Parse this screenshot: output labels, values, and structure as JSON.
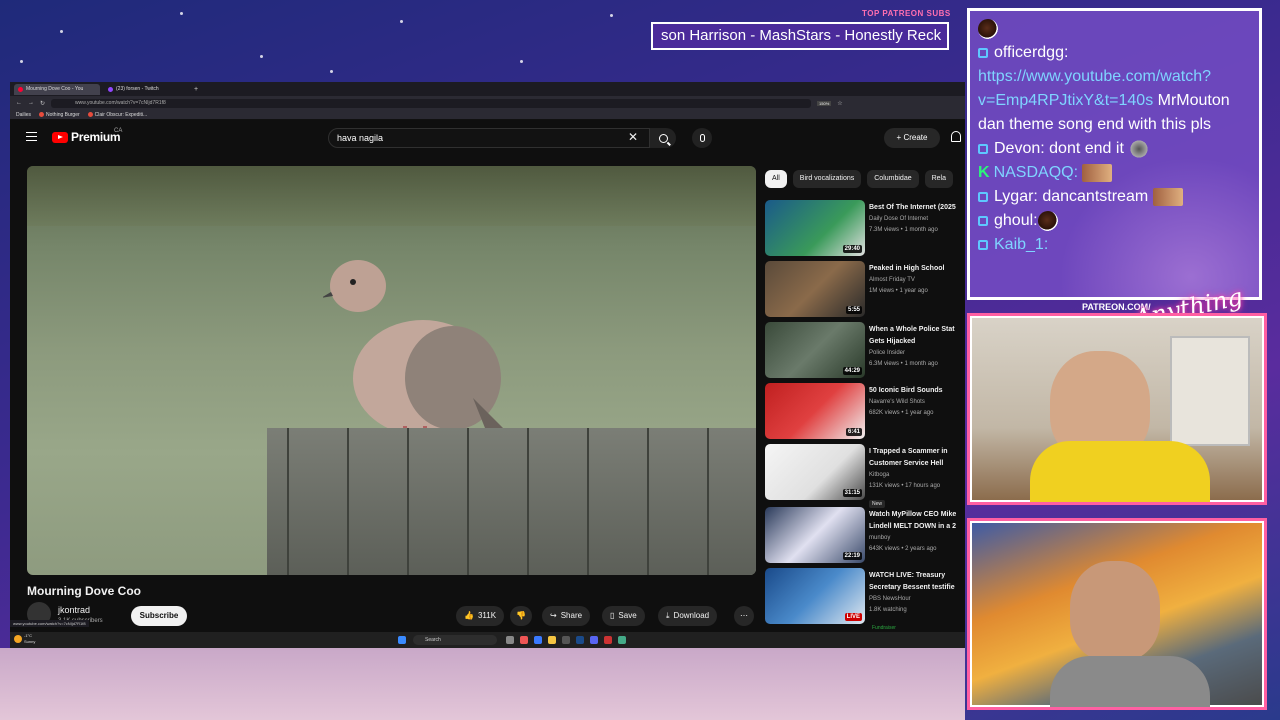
{
  "overlay": {
    "patreon_tag": "TOP PATREON SUBS",
    "ticker": "son Harrison - MashStars - Honestly Reck",
    "patreon_link": "PATREON.COM/",
    "brand_script": "Anything Else?"
  },
  "browser": {
    "tabs": [
      {
        "label": "Mourning Dove Coo - You"
      },
      {
        "label": "(23) forsen - Twitch"
      }
    ],
    "new_tab": "+",
    "url": "www.youtube.com/watch?v=7cNIjd7R1f8",
    "zoom": "150%",
    "bookmarks": [
      "Dailies",
      "Nothing Burger",
      "Clair Obscur: Expediti..."
    ],
    "status_url": "www.youtube.com/watch?v=7cNIjd7R1f8"
  },
  "youtube": {
    "logo_text": "Premium",
    "region": "CA",
    "search_value": "hava nagila",
    "create_label": "Create",
    "video_title": "Mourning Dove Coo",
    "channel_name": "jkontrad",
    "subscribers": "3.1K subscribers",
    "subscribe_label": "Subscribe",
    "like_count": "311K",
    "share_label": "Share",
    "save_label": "Save",
    "download_label": "Download",
    "chips": [
      "All",
      "Bird vocalizations",
      "Columbidae",
      "Rela"
    ],
    "recommendations": [
      {
        "title": "Best Of The Internet (2025",
        "channel": "Daily Dose Of Internet",
        "info": "7.3M views • 1 month ago",
        "duration": "29:40"
      },
      {
        "title": "Peaked in High School",
        "channel": "Almost Friday TV",
        "info": "1M views • 1 year ago",
        "duration": "5:55"
      },
      {
        "title": "When a Whole Police Stat",
        "title2": "Gets Hijacked",
        "channel": "Police Insider",
        "info": "6.3M views • 1 month ago",
        "duration": "44:29"
      },
      {
        "title": "50 Iconic Bird Sounds",
        "channel": "Navarre's Wild Shots",
        "info": "682K views • 1 year ago",
        "duration": "6:41"
      },
      {
        "title": "I Trapped a Scammer in",
        "title2": "Customer Service Hell",
        "channel": "Kitboga",
        "info": "131K views • 17 hours ago",
        "duration": "31:15",
        "badge": "New"
      },
      {
        "title": "Watch MyPillow CEO Mike",
        "title2": "Lindell MELT DOWN in a 2",
        "channel": "munboy",
        "info": "643K views • 2 years ago",
        "duration": "22:19"
      },
      {
        "title": "WATCH LIVE: Treasury",
        "title2": "Secretary Bessent testifie",
        "channel": "PBS NewsHour",
        "info": "1.8K watching",
        "duration": "LIVE",
        "badge": "Fundraiser"
      }
    ]
  },
  "taskbar": {
    "weather_temp": "-1°C",
    "weather_desc": "Sunny",
    "search_placeholder": "Search"
  },
  "chat": {
    "messages": [
      {
        "user": "",
        "text": ""
      },
      {
        "user": "officerdgg:",
        "text": ""
      },
      {
        "link": "https://www.youtube.com/watch?v=Emp4RPJtixY&t=140s",
        "text": "MrMouton dan theme song end with this pls"
      },
      {
        "user": "Devon:",
        "text": "dont end it"
      },
      {
        "user": "NASDAQQ:",
        "text": ""
      },
      {
        "user": "Lygar:",
        "text": "dancantstream"
      },
      {
        "user": "ghoul:",
        "text": ""
      },
      {
        "user": "Kaib_1:",
        "text": ""
      }
    ],
    "link_line1": "https://www.youtube.com/watch?",
    "link_line2": "v=Emp4RPJtixY&t=140s",
    "link_suffix": " MrMouton",
    "link_line3": "dan theme song end with this pls"
  }
}
